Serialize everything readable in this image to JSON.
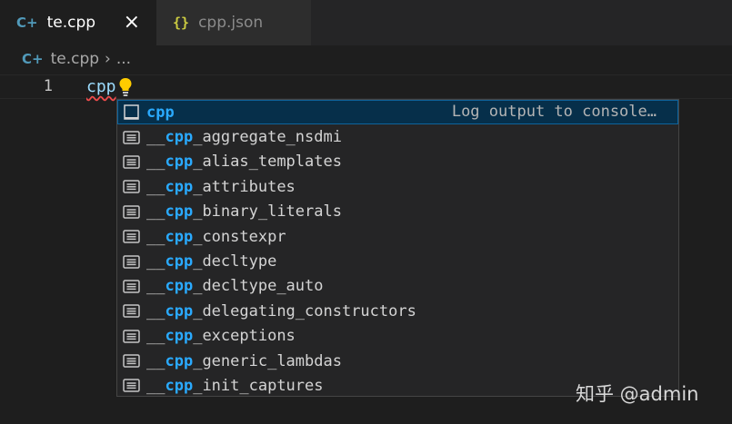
{
  "tabs": [
    {
      "label": "te.cpp",
      "icon": "cpp-file-icon",
      "active": true,
      "close": "×"
    },
    {
      "label": "cpp.json",
      "icon": "json-file-icon",
      "active": false
    }
  ],
  "breadcrumb": {
    "file": "te.cpp",
    "separator": "›",
    "rest": "..."
  },
  "editor": {
    "line_number": "1",
    "typed_text": "cpp"
  },
  "suggest": {
    "selected": {
      "label": "cpp",
      "detail": "Log output to console…"
    },
    "items": [
      {
        "prefix": "__",
        "match": "cpp",
        "rest": "_aggregate_nsdmi"
      },
      {
        "prefix": "__",
        "match": "cpp",
        "rest": "_alias_templates"
      },
      {
        "prefix": "__",
        "match": "cpp",
        "rest": "_attributes"
      },
      {
        "prefix": "__",
        "match": "cpp",
        "rest": "_binary_literals"
      },
      {
        "prefix": "__",
        "match": "cpp",
        "rest": "_constexpr"
      },
      {
        "prefix": "__",
        "match": "cpp",
        "rest": "_decltype"
      },
      {
        "prefix": "__",
        "match": "cpp",
        "rest": "_decltype_auto"
      },
      {
        "prefix": "__",
        "match": "cpp",
        "rest": "_delegating_constructors"
      },
      {
        "prefix": "__",
        "match": "cpp",
        "rest": "_exceptions"
      },
      {
        "prefix": "__",
        "match": "cpp",
        "rest": "_generic_lambdas"
      },
      {
        "prefix": "__",
        "match": "cpp",
        "rest": "_init_captures"
      }
    ]
  },
  "watermark": "知乎 @admin",
  "colors": {
    "accent": "#2aaaff",
    "selection_bg": "#062f4a",
    "error_squiggle": "#f14c4c",
    "bulb": "#ffcc00"
  }
}
